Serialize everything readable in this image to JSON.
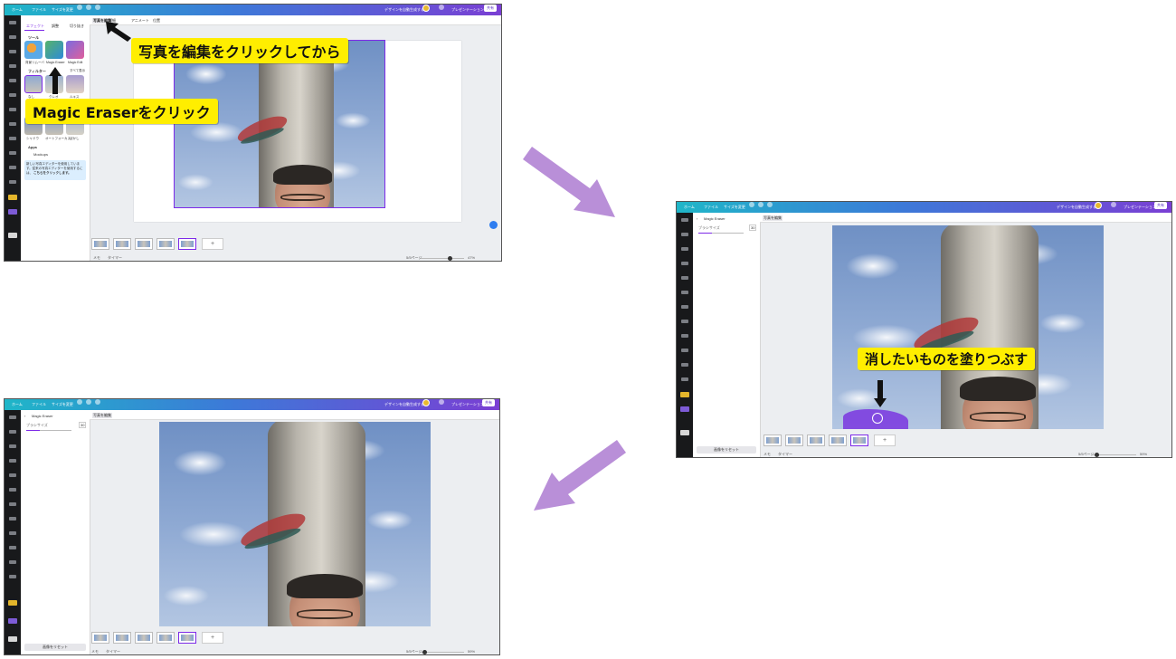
{
  "topbar": {
    "home": "ホーム",
    "file": "ファイル",
    "resize": "サイズを変更",
    "name_placeholder": "デザインを自動生成する",
    "present": "プレゼンテーション",
    "share": "共有"
  },
  "shot1": {
    "panel_tabs": [
      "エフェクト",
      "調整",
      "切り抜き"
    ],
    "tools_heading": "ツール",
    "tools": [
      "背景リムーバ",
      "Magic Eraser",
      "Magic Edit"
    ],
    "filters_heading": "フィルター",
    "see_all": "すべて表示",
    "filters": [
      "なし",
      "クレオ",
      "ルキス"
    ],
    "effects": [
      "シャドウ",
      "オートフォーカス",
      "ぼかし"
    ],
    "apps_heading": "Apps",
    "app_item": "Mockups",
    "info_text": "新しい写真エディターを使用しています。従来の写真エディターを使用するには、",
    "info_link": "こちらをクリックします。",
    "toolbar": [
      "写真を編集",
      "詳細",
      "アニメート",
      "位置"
    ],
    "status_notes": "メモ",
    "status_timer": "タイマー",
    "status_page": "5/5ページ",
    "status_zoom": "47%"
  },
  "shot2": {
    "panel_title": "Magic Eraser",
    "brush_label": "ブラシサイズ",
    "brush_value": "30",
    "reset": "画像をリセット",
    "toolbar": "写真を編集",
    "status_notes": "メモ",
    "status_timer": "タイマー",
    "status_page": "5/5ページ",
    "status_zoom": "59%"
  },
  "shot3": {
    "panel_title": "Magic Eraser",
    "brush_label": "ブラシサイズ",
    "brush_value": "30",
    "reset": "画像をリセット",
    "toolbar": "写真を編集",
    "status_notes": "メモ",
    "status_timer": "タイマー",
    "status_page": "5/5ページ",
    "status_zoom": "59%"
  },
  "callouts": {
    "edit_photo": "写真を編集をクリックしてから",
    "magic_eraser": "Magic Eraserをクリック",
    "paint": "消したいものを塗りつぶす"
  },
  "colors": {
    "callout_bg": "#ffee00",
    "flow_arrow": "#b98fd8",
    "accent": "#7d2ae8",
    "rail": "#18191b"
  }
}
